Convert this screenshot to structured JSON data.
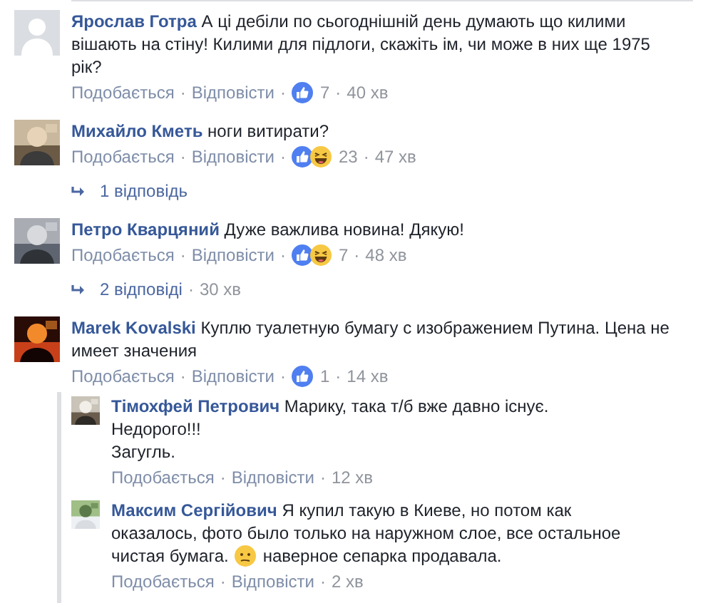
{
  "separator": "·",
  "comments": [
    {
      "author": "Ярослав Готра",
      "avatar": {
        "kind": "silhouette"
      },
      "text": "А ці дебіли по сьогоднішній день думають що килими вішають на стіну! Килими для підлоги, скажіть ім, чи може в них ще 1975 рік?",
      "like": "Подобається",
      "reply": "Відповісти",
      "reactions": [
        {
          "kind": "like"
        }
      ],
      "count": "7",
      "time": "40 хв"
    },
    {
      "author": "Михайло Кметь",
      "avatar": {
        "kind": "picture"
      },
      "text": "ноги витирати?",
      "like": "Подобається",
      "reply": "Відповісти",
      "reactions": [
        {
          "kind": "like"
        },
        {
          "kind": "haha"
        }
      ],
      "count": "23",
      "time": "47 хв",
      "replies_link": {
        "label": "1 відповідь"
      }
    },
    {
      "author": "Петро Кварцяний",
      "avatar": {
        "kind": "picture"
      },
      "text": "Дуже важлива новина! Дякую!",
      "like": "Подобається",
      "reply": "Відповісти",
      "reactions": [
        {
          "kind": "like"
        },
        {
          "kind": "haha"
        }
      ],
      "count": "7",
      "time": "48 хв",
      "replies_link": {
        "label": "2 відповіді",
        "time": "30 хв"
      }
    },
    {
      "author": "Marek Kovalski",
      "avatar": {
        "kind": "picture"
      },
      "text": "Куплю туалетную бумагу с изображением Путина. Цена не имеет значения",
      "like": "Подобається",
      "reply": "Відповісти",
      "reactions": [
        {
          "kind": "like"
        }
      ],
      "count": "1",
      "time": "14 хв",
      "replies": [
        {
          "author": "Тімохфей Петрович",
          "avatar": {
            "kind": "picture"
          },
          "lines": [
            "Марику, така т/б вже давно існує.",
            "Недорого!!!",
            "Загугль."
          ],
          "like": "Подобається",
          "reply": "Відповісти",
          "time": "12 хв"
        },
        {
          "author": "Максим Сергійович",
          "avatar": {
            "kind": "picture"
          },
          "text": "Я купил такую в Киеве, но потом как оказалось, фото было только на наружном слое, все остальное чистая бумага.",
          "emoji": {
            "kind": "confused"
          },
          "text_after": "наверное сепарка продавала.",
          "like": "Подобається",
          "reply": "Відповісти",
          "time": "2 хв"
        }
      ]
    }
  ]
}
